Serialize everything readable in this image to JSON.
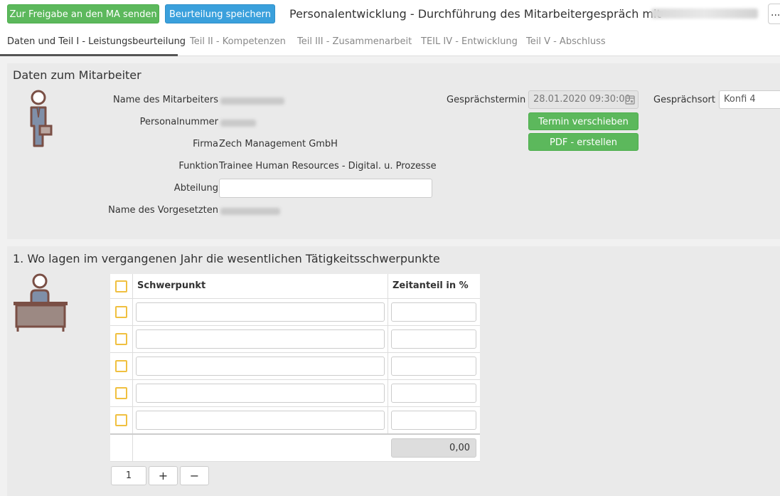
{
  "topbar": {
    "send_button": "Zur Freigabe an den MA senden",
    "save_button": "Beurteilung speichern",
    "title": "Personalentwicklung - Durchführung des Mitarbeitergespräch mit",
    "more_button": "..."
  },
  "tabs": [
    {
      "label": "Daten und Teil I - Leistungsbeurteilung",
      "active": true
    },
    {
      "label": "Teil II - Kompetenzen"
    },
    {
      "label": "Teil III - Zusammenarbeit"
    },
    {
      "label": "TEIL IV - Entwicklung"
    },
    {
      "label": "Teil V - Abschluss"
    }
  ],
  "employee_section": {
    "title": "Daten zum Mitarbeiter",
    "labels": {
      "name": "Name des Mitarbeiters",
      "personnel_number": "Personalnummer",
      "company": "Firma",
      "function": "Funktion",
      "department": "Abteilung",
      "supervisor": "Name des Vorgesetzten",
      "appointment": "Gesprächstermin",
      "location": "Gesprächsort"
    },
    "values": {
      "company": "Zech Management GmbH",
      "function": "Trainee Human Resources - Digital. u. Prozesse",
      "department": "",
      "appointment": "28.01.2020 09:30:00",
      "location": "Konfi 4"
    },
    "buttons": {
      "reschedule": "Termin verschieben",
      "pdf": "PDF - erstellen"
    }
  },
  "focus_section": {
    "title": "1. Wo lagen im vergangenen Jahr die wesentlichen Tätigkeitsschwerpunkte",
    "columns": {
      "focus": "Schwerpunkt",
      "share": "Zeitanteil in %"
    },
    "total": "0,00",
    "pager": {
      "count": "1",
      "add": "+",
      "remove": "−"
    }
  },
  "colors": {
    "green": "#5cb85c",
    "blue": "#3aa0dc",
    "checkbox": "#f0c040",
    "icon": "#7a4f45"
  }
}
